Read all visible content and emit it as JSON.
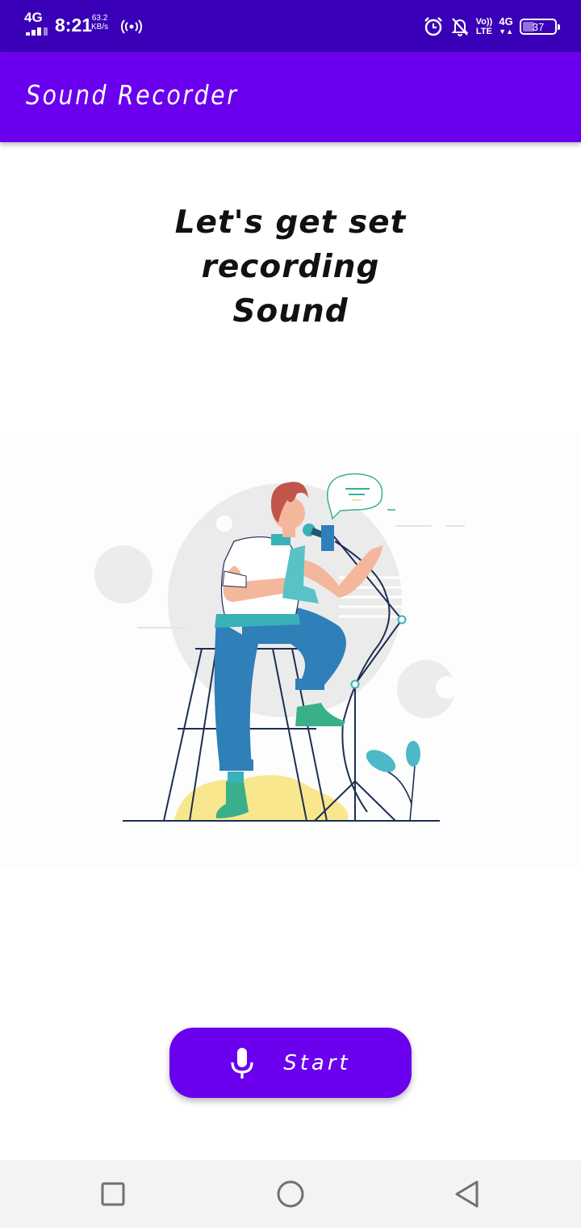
{
  "status_bar": {
    "network": "4G",
    "time": "8:21",
    "speed_value": "63.2",
    "speed_unit": "KB/s",
    "volte_top": "Vo))",
    "volte_bottom": "LTE",
    "network_right": "4G",
    "battery": "37",
    "icons": [
      "signal-icon",
      "hotspot-icon",
      "alarm-icon",
      "notifications-off-icon",
      "battery-icon"
    ]
  },
  "app_bar": {
    "title": "Sound Recorder",
    "color": "#6a00ee"
  },
  "headline": "Let's get set\nrecording\nSound",
  "illustration": {
    "icon": "singer-with-microphone-illustration"
  },
  "start_button": {
    "label": "Start",
    "icon": "microphone-icon",
    "color": "#6a00ee"
  },
  "nav_bar": {
    "icons": [
      "recent-apps-icon",
      "home-icon",
      "back-icon"
    ]
  }
}
